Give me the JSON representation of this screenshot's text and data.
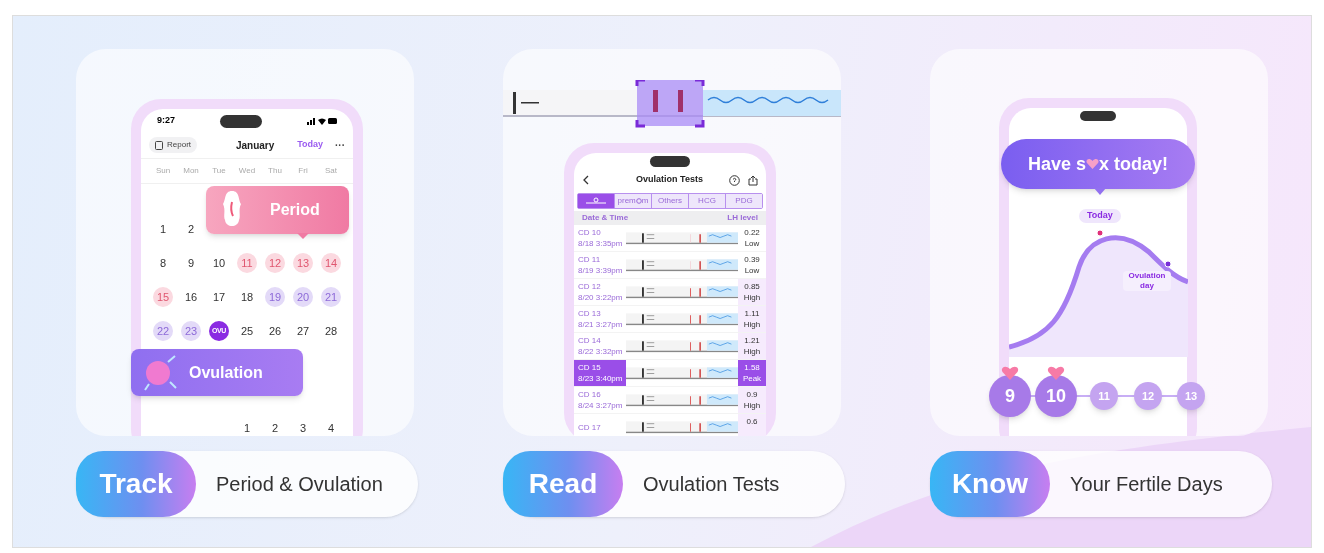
{
  "cards": [
    {
      "kind": "calendar",
      "pill": {
        "word": "Track",
        "caption": "Period & Ovulation"
      },
      "phone": {
        "time": "9:27",
        "report": "Report",
        "month": "January",
        "today": "Today",
        "more": "···",
        "weekdays": [
          "Sun",
          "Mon",
          "Tue",
          "Wed",
          "Thu",
          "Fri",
          "Sat"
        ],
        "weeks": [
          [
            {
              "day": "1",
              "kind": "plain"
            },
            {
              "day": "2",
              "kind": "plain"
            },
            {
              "kind": "blank"
            },
            {
              "kind": "blank"
            },
            {
              "kind": "blank"
            },
            {
              "kind": "blank"
            },
            {
              "kind": "blank"
            }
          ],
          [
            {
              "day": "8",
              "kind": "plain"
            },
            {
              "day": "9",
              "kind": "plain"
            },
            {
              "day": "10",
              "kind": "plain"
            },
            {
              "day": "11",
              "kind": "period"
            },
            {
              "day": "12",
              "kind": "period"
            },
            {
              "day": "13",
              "kind": "period"
            },
            {
              "day": "14",
              "kind": "period"
            }
          ],
          [
            {
              "day": "15",
              "kind": "period"
            },
            {
              "day": "16",
              "kind": "plain"
            },
            {
              "day": "17",
              "kind": "plain"
            },
            {
              "day": "18",
              "kind": "plain"
            },
            {
              "day": "19",
              "kind": "fertile"
            },
            {
              "day": "20",
              "kind": "fertile"
            },
            {
              "day": "21",
              "kind": "fertile"
            }
          ],
          [
            {
              "day": "22",
              "kind": "fertile"
            },
            {
              "day": "23",
              "kind": "fertile"
            },
            {
              "day": "OVU",
              "kind": "ovulation"
            },
            {
              "day": "25",
              "kind": "plain"
            },
            {
              "day": "26",
              "kind": "plain"
            },
            {
              "day": "27",
              "kind": "plain"
            },
            {
              "day": "28",
              "kind": "plain"
            }
          ]
        ],
        "next_week": [
          {
            "kind": "blank"
          },
          {
            "kind": "blank"
          },
          {
            "kind": "blank"
          },
          {
            "day": "1",
            "kind": "plain"
          },
          {
            "day": "2",
            "kind": "plain"
          },
          {
            "day": "3",
            "kind": "plain"
          },
          {
            "day": "4",
            "kind": "plain"
          }
        ],
        "period_bubble": "Period",
        "ovulation_bubble": "Ovulation"
      }
    },
    {
      "kind": "tests",
      "pill": {
        "word": "Read",
        "caption": "Ovulation Tests"
      },
      "phone": {
        "title": "Ovulation Tests",
        "tabs": [
          {
            "kind": "logo",
            "selected": true
          },
          {
            "kind": "split",
            "parts": [
              "prem",
              "m"
            ],
            "selected": false
          },
          {
            "kind": "text",
            "label": "Others",
            "selected": false
          },
          {
            "kind": "text",
            "label": "HCG",
            "selected": false
          },
          {
            "kind": "text",
            "label": "PDG",
            "selected": false
          }
        ],
        "columns": [
          "Date & Time",
          "LH level"
        ],
        "rows": [
          {
            "cd": "CD 10",
            "date": "8/18  3:35pm",
            "value": "0.22",
            "result": "Low",
            "kind": "low",
            "selected": false
          },
          {
            "cd": "CD 11",
            "date": "8/19  3:39pm",
            "value": "0.39",
            "result": "Low",
            "kind": "low",
            "selected": false
          },
          {
            "cd": "CD 12",
            "date": "8/20  3:22pm",
            "value": "0.85",
            "result": "High",
            "kind": "high",
            "selected": false
          },
          {
            "cd": "CD 13",
            "date": "8/21  3:27pm",
            "value": "1.11",
            "result": "High",
            "kind": "high",
            "selected": false
          },
          {
            "cd": "CD 14",
            "date": "8/22  3:32pm",
            "value": "1.21",
            "result": "High",
            "kind": "high",
            "selected": false
          },
          {
            "cd": "CD 15",
            "date": "8/23  3:40pm",
            "value": "1.58",
            "result": "Peak",
            "kind": "high",
            "selected": true
          },
          {
            "cd": "CD 16",
            "date": "8/24  3:27pm",
            "value": "0.9",
            "result": "High",
            "kind": "high",
            "selected": false
          },
          {
            "cd": "CD 17",
            "value": "0.6",
            "kind": "high",
            "selected": false
          }
        ]
      }
    },
    {
      "kind": "fertile",
      "pill": {
        "word": "Know",
        "caption": "Your Fertile Days"
      },
      "phone": {
        "bubble_start": "Have s",
        "bubble_end": "x today!",
        "today": "Today",
        "ovulation": "Ovulation day",
        "days": [
          {
            "day": "9",
            "hearted": true,
            "large": true
          },
          {
            "day": "10",
            "hearted": true,
            "large": true
          },
          {
            "day": "11",
            "hearted": false,
            "large": false
          },
          {
            "day": "12",
            "hearted": false,
            "large": false
          },
          {
            "day": "13",
            "hearted": false,
            "large": false
          }
        ]
      }
    }
  ]
}
